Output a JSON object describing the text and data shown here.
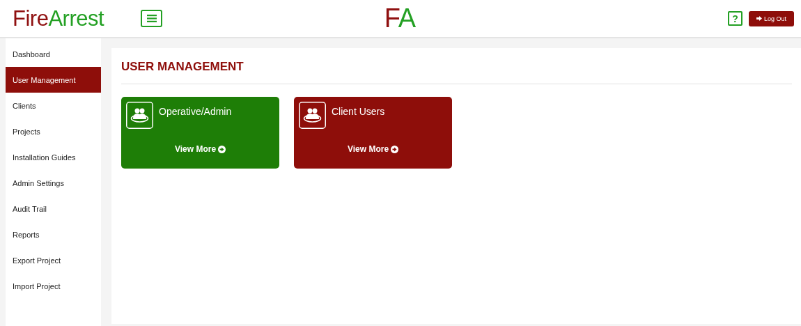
{
  "logo": [
    {
      "text": "Fire",
      "color": "#8f1010"
    },
    {
      "text": "Arrest",
      "color": "#23a023"
    }
  ],
  "center_logo": [
    {
      "text": "F",
      "color": "#8f1010"
    },
    {
      "text": "A",
      "color": "#23a023"
    }
  ],
  "header": {
    "help": "?",
    "logout": "Log Out"
  },
  "sidebar": {
    "items": [
      {
        "label": "Dashboard",
        "selected": false
      },
      {
        "label": "User Management",
        "selected": true
      },
      {
        "label": "Clients",
        "selected": false
      },
      {
        "label": "Projects",
        "selected": false
      },
      {
        "label": "Installation Guides",
        "selected": false
      },
      {
        "label": "Admin Settings",
        "selected": false
      },
      {
        "label": "Audit Trail",
        "selected": false
      },
      {
        "label": "Reports",
        "selected": false
      },
      {
        "label": "Export Project",
        "selected": false
      },
      {
        "label": "Import Project",
        "selected": false
      }
    ]
  },
  "page": {
    "title": "USER MANAGEMENT"
  },
  "cards": [
    {
      "title": "Operative/Admin",
      "link": "View More",
      "color": "#1e7e07"
    },
    {
      "title": "Client Users",
      "link": "View More",
      "color": "#8e0e0a"
    }
  ]
}
